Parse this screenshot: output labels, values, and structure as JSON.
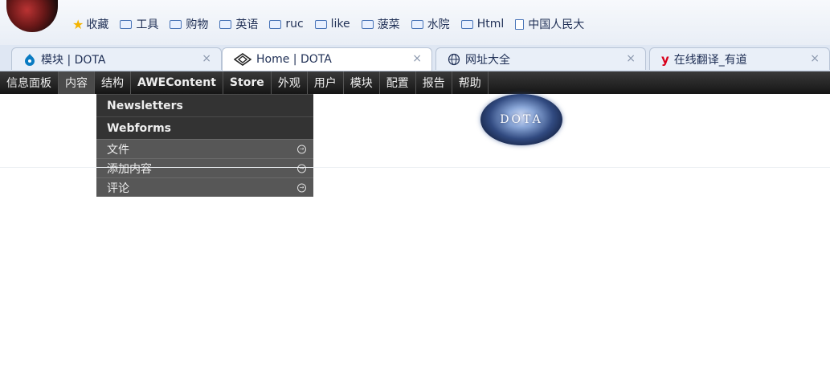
{
  "bookmarks": [
    {
      "label": "收藏",
      "icon": "star-icon"
    },
    {
      "label": "工具",
      "icon": "folder-icon"
    },
    {
      "label": "购物",
      "icon": "folder-icon"
    },
    {
      "label": "英语",
      "icon": "folder-icon"
    },
    {
      "label": "ruc",
      "icon": "folder-icon"
    },
    {
      "label": "like",
      "icon": "folder-icon"
    },
    {
      "label": "菠菜",
      "icon": "folder-icon"
    },
    {
      "label": "水院",
      "icon": "folder-icon"
    },
    {
      "label": "Html",
      "icon": "folder-icon"
    },
    {
      "label": "中国人民大",
      "icon": "document-icon"
    }
  ],
  "tabs": [
    {
      "title": "模块 | DOTA",
      "close": "×"
    },
    {
      "title": "Home | DOTA",
      "close": "×"
    },
    {
      "title": "网址大全",
      "close": "×"
    },
    {
      "title": "在线翻译_有道",
      "close": "×"
    }
  ],
  "admin_menu": [
    "信息面板",
    "内容",
    "结构",
    "AWEContent",
    "Store",
    "外观",
    "用户",
    "模块",
    "配置",
    "报告",
    "帮助"
  ],
  "dropdown": [
    {
      "label": "Newsletters"
    },
    {
      "label": "Webforms"
    },
    {
      "label": "文件"
    },
    {
      "label": "添加内容"
    },
    {
      "label": "评论"
    }
  ],
  "logo_text": "DOTA",
  "colors": {
    "admin_bar": "#1f1f1f",
    "dropdown_bg": "#444444",
    "bookmark_text": "#1f2f55"
  }
}
